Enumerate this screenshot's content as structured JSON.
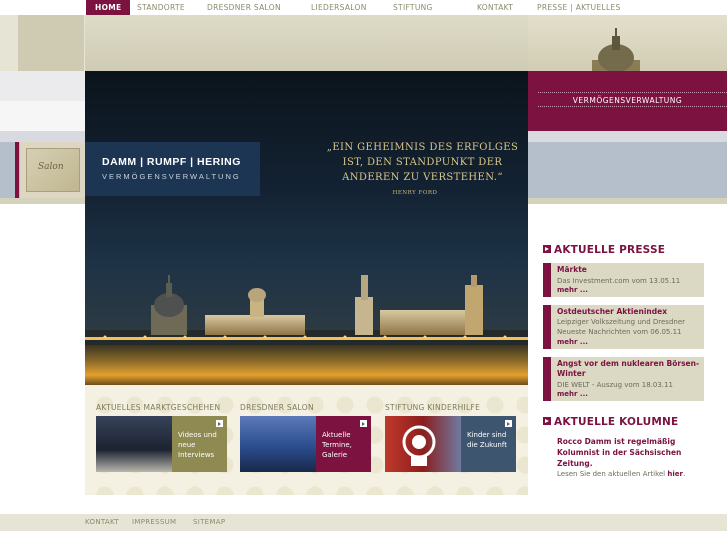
{
  "nav": {
    "items": [
      {
        "label": "HOME",
        "active": true
      },
      {
        "label": "STANDORTE"
      },
      {
        "label": "DRESDNER SALON"
      },
      {
        "label": "LIEDERSALON"
      },
      {
        "label": "STIFTUNG"
      },
      {
        "label": "KONTAKT"
      },
      {
        "label": "PRESSE | AKTUELLES"
      }
    ]
  },
  "salon_logo": {
    "text": "Salon"
  },
  "brand": {
    "name": "DAMM | RUMPF | HERING",
    "subtitle": "VERMÖGENSVERWALTUNG"
  },
  "quote": {
    "lines": [
      "„EIN GEHEIMNIS DES ERFOLGES",
      "IST, DEN STANDPUNKT DER",
      "ANDEREN ZU VERSTEHEN.“"
    ],
    "author": "HENRY FORD"
  },
  "right_panel": {
    "label": "VERMÖGENSVERWALTUNG"
  },
  "press": {
    "heading": "AKTUELLE PRESSE",
    "items": [
      {
        "title": "Märkte",
        "text": "Das Investment.com vom 13.05.11",
        "more": "mehr ..."
      },
      {
        "title": "Ostdeutscher Aktienindex",
        "text": "Leipziger Volkszeitung und Dresdner Neueste Nachrichten vom 06.05.11",
        "more": "mehr ..."
      },
      {
        "title": "Angst vor dem nuklearen Börsen-Winter",
        "text": "DIE WELT - Auszug vom 18.03.11",
        "more": "mehr ..."
      }
    ]
  },
  "kolumne": {
    "heading": "AKTUELLE KOLUMNE",
    "text": "Rocco Damm ist regelmäßig Kolumnist in der Sächsischen Zeitung.",
    "sub_prefix": "Lesen Sie den aktuellen Artikel",
    "link": "hier",
    "sub_suffix": "."
  },
  "teasers": [
    {
      "heading": "AKTUELLES MARKTGESCHEHEN",
      "caption": "Videos und neue Interviews",
      "color": "#8e8a52"
    },
    {
      "heading": "DRESDNER SALON",
      "caption": "Aktuelle Termine, Galerie",
      "color": "#7b1240"
    },
    {
      "heading": "STIFTUNG KINDERHILFE",
      "caption": "Kinder sind die Zukunft",
      "color": "#3e5570"
    }
  ],
  "footer": {
    "items": [
      "KONTAKT",
      "IMPRESSUM",
      "SITEMAP"
    ]
  },
  "colors": {
    "accent": "#7b1240",
    "brand_blue": "#1c3552",
    "olive": "#8e8a52",
    "steel_blue": "#3e5570"
  }
}
